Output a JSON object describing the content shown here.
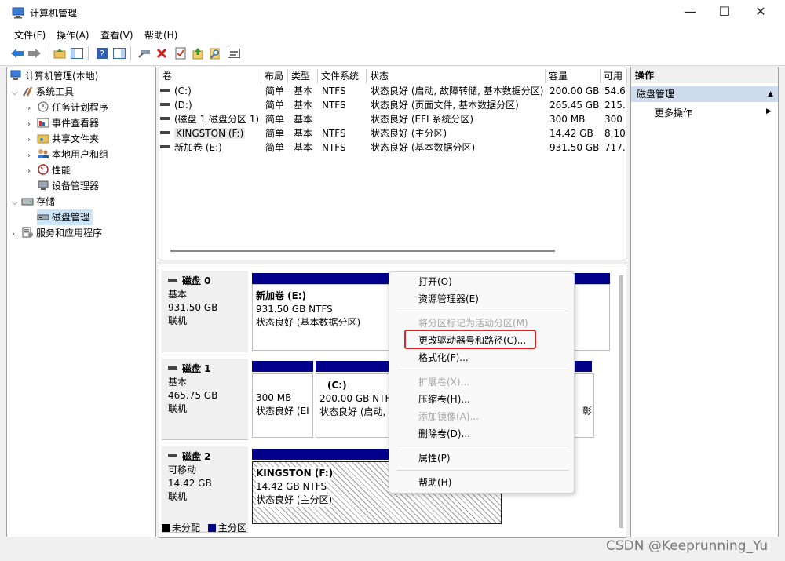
{
  "window": {
    "title": "计算机管理",
    "minimize_glyph": "—",
    "maximize_glyph": "☐",
    "close_glyph": "✕"
  },
  "menu": [
    "文件(F)",
    "操作(A)",
    "查看(V)",
    "帮助(H)"
  ],
  "tree": {
    "root": "计算机管理(本地)",
    "system_tools": "系统工具",
    "task_scheduler": "任务计划程序",
    "event_viewer": "事件查看器",
    "shared_folders": "共享文件夹",
    "local_users": "本地用户和组",
    "performance": "性能",
    "device_manager": "设备管理器",
    "storage": "存储",
    "disk_management": "磁盘管理",
    "services_apps": "服务和应用程序"
  },
  "volume_table": {
    "headers": [
      "卷",
      "布局",
      "类型",
      "文件系统",
      "状态",
      "容量",
      "可用"
    ],
    "rows": [
      {
        "name": "(C:)",
        "layout": "简单",
        "type": "基本",
        "fs": "NTFS",
        "status": "状态良好 (启动, 故障转储, 基本数据分区)",
        "capacity": "200.00 GB",
        "free": "54.6"
      },
      {
        "name": "(D:)",
        "layout": "简单",
        "type": "基本",
        "fs": "NTFS",
        "status": "状态良好 (页面文件, 基本数据分区)",
        "capacity": "265.45 GB",
        "free": "215."
      },
      {
        "name": "(磁盘 1 磁盘分区 1)",
        "layout": "简单",
        "type": "基本",
        "fs": "",
        "status": "状态良好 (EFI 系统分区)",
        "capacity": "300 MB",
        "free": "300"
      },
      {
        "name": "KINGSTON (F:)",
        "layout": "简单",
        "type": "基本",
        "fs": "NTFS",
        "status": "状态良好 (主分区)",
        "capacity": "14.42 GB",
        "free": "8.10"
      },
      {
        "name": "新加卷 (E:)",
        "layout": "简单",
        "type": "基本",
        "fs": "NTFS",
        "status": "状态良好 (基本数据分区)",
        "capacity": "931.50 GB",
        "free": "717."
      }
    ]
  },
  "disks": [
    {
      "name": "磁盘 0",
      "kind": "基本",
      "size": "931.50 GB",
      "state": "联机",
      "partitions": [
        {
          "title": "新加卷  (E:)",
          "line2": "931.50 GB NTFS",
          "line3": "状态良好 (基本数据分区)"
        }
      ]
    },
    {
      "name": "磁盘 1",
      "kind": "基本",
      "size": "465.75 GB",
      "state": "联机",
      "partitions": [
        {
          "title": "",
          "line2": "300 MB",
          "line3": "状态良好 (EI"
        },
        {
          "title": "(C:)",
          "line2": "200.00 GB NTF",
          "line3": "状态良好 (启动,"
        },
        {
          "title": "",
          "line2": "",
          "line3": "彰"
        }
      ]
    },
    {
      "name": "磁盘 2",
      "kind": "可移动",
      "size": "14.42 GB",
      "state": "联机",
      "partitions": [
        {
          "title": "KINGSTON  (F:)",
          "line2": "14.42 GB NTFS",
          "line3": "状态良好 (主分区)"
        }
      ]
    }
  ],
  "legend": {
    "unallocated": "未分配",
    "primary": "主分区"
  },
  "actions": {
    "header": "操作",
    "section": "磁盘管理",
    "more": "更多操作"
  },
  "context_menu": {
    "open": "打开(O)",
    "explore": "资源管理器(E)",
    "mark_active": "将分区标记为活动分区(M)",
    "change_letter": "更改驱动器号和路径(C)...",
    "format": "格式化(F)...",
    "extend": "扩展卷(X)...",
    "shrink": "压缩卷(H)...",
    "mirror": "添加镜像(A)...",
    "delete": "删除卷(D)...",
    "properties": "属性(P)",
    "help": "帮助(H)"
  },
  "watermark": "CSDN @Keeprunning_Yu",
  "colors": {
    "primary_partition": "#00008b",
    "highlight_box": "#e0242a",
    "selection": "#cce4f7"
  }
}
